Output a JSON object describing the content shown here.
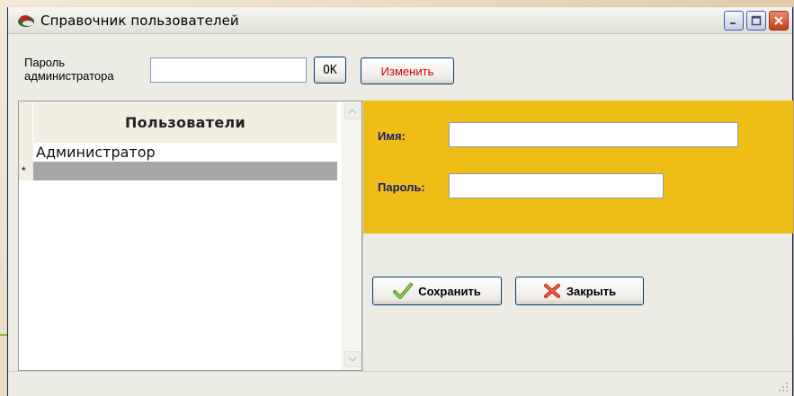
{
  "window": {
    "title": "Справочник пользователей"
  },
  "toolbar": {
    "admin_password_label": "Пароль администратора",
    "admin_password_value": "",
    "ok_label": "OK",
    "change_label": "Изменить"
  },
  "users_grid": {
    "column_header": "Пользователи",
    "rows": [
      {
        "marker": "",
        "name": "Администратор"
      },
      {
        "marker": "*",
        "name": ""
      }
    ]
  },
  "user_form": {
    "name_label": "Имя:",
    "name_value": "",
    "password_label": "Пароль:",
    "password_value": ""
  },
  "actions": {
    "save_label": "Сохранить",
    "close_label": "Закрыть"
  },
  "icons": {
    "app": "app-icon",
    "minimize": "minimize-icon",
    "maximize": "maximize-icon",
    "close": "close-icon",
    "save": "checkmark-icon",
    "close_action": "red-x-icon"
  },
  "colors": {
    "form_panel_bg": "#eebd16",
    "change_button_text": "#d40000",
    "label_text": "#1a1a6b",
    "selected_row_bg": "#a6a6a6"
  }
}
